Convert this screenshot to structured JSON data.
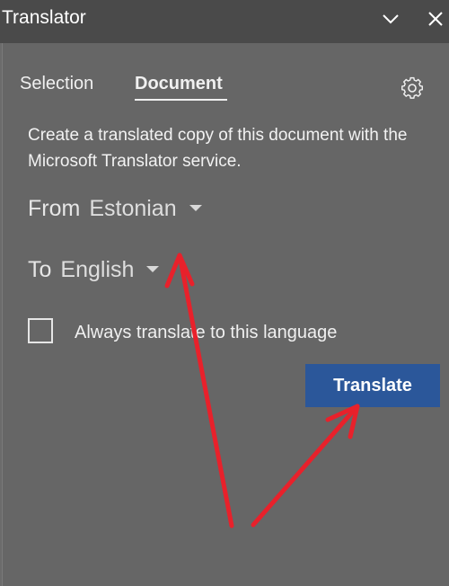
{
  "window": {
    "title": "Translator"
  },
  "tabs": [
    {
      "label": "Selection",
      "active": false
    },
    {
      "label": "Document",
      "active": true
    }
  ],
  "description": "Create a translated copy of this document with the Microsoft Translator service.",
  "from": {
    "label": "From",
    "value": "Estonian"
  },
  "to": {
    "label": "To",
    "value": "English"
  },
  "always_translate": {
    "label": "Always translate to this language",
    "checked": false
  },
  "translate_button": {
    "label": "Translate"
  },
  "colors": {
    "titlebar": "#4a4a4a",
    "pane": "#666666",
    "accent_button": "#2b579a",
    "annotation_arrow": "#e8212b"
  },
  "icons": {
    "collapse": "chevron-down-icon",
    "close": "close-icon",
    "settings": "gear-icon",
    "dropdown": "caret-down-icon"
  }
}
